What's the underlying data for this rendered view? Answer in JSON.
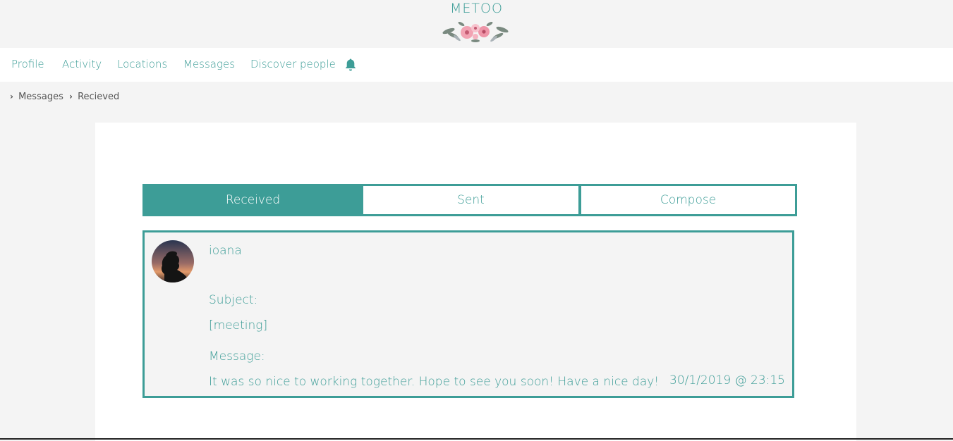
{
  "brand": {
    "title": "METOO"
  },
  "nav": {
    "items": [
      {
        "label": "Profile"
      },
      {
        "label": "Activity"
      },
      {
        "label": "Locations"
      },
      {
        "label": "Messages"
      },
      {
        "label": "Discover people"
      }
    ],
    "notification_icon": "bell-icon"
  },
  "breadcrumb": {
    "items": [
      "Messages",
      "Recieved"
    ]
  },
  "tabs": [
    {
      "label": "Received",
      "active": true
    },
    {
      "label": "Sent",
      "active": false
    },
    {
      "label": "Compose",
      "active": false
    }
  ],
  "message": {
    "sender": "ioana",
    "subject_label": "Subject:",
    "subject": "[meeting]",
    "message_label": "Message:",
    "body": "It was so nice to working together. Hope to see you soon! Have a nice day!",
    "timestamp": "30/1/2019 @ 23:15"
  },
  "colors": {
    "accent": "#3d9d97",
    "background": "#f4f4f4",
    "card": "#ffffff"
  }
}
